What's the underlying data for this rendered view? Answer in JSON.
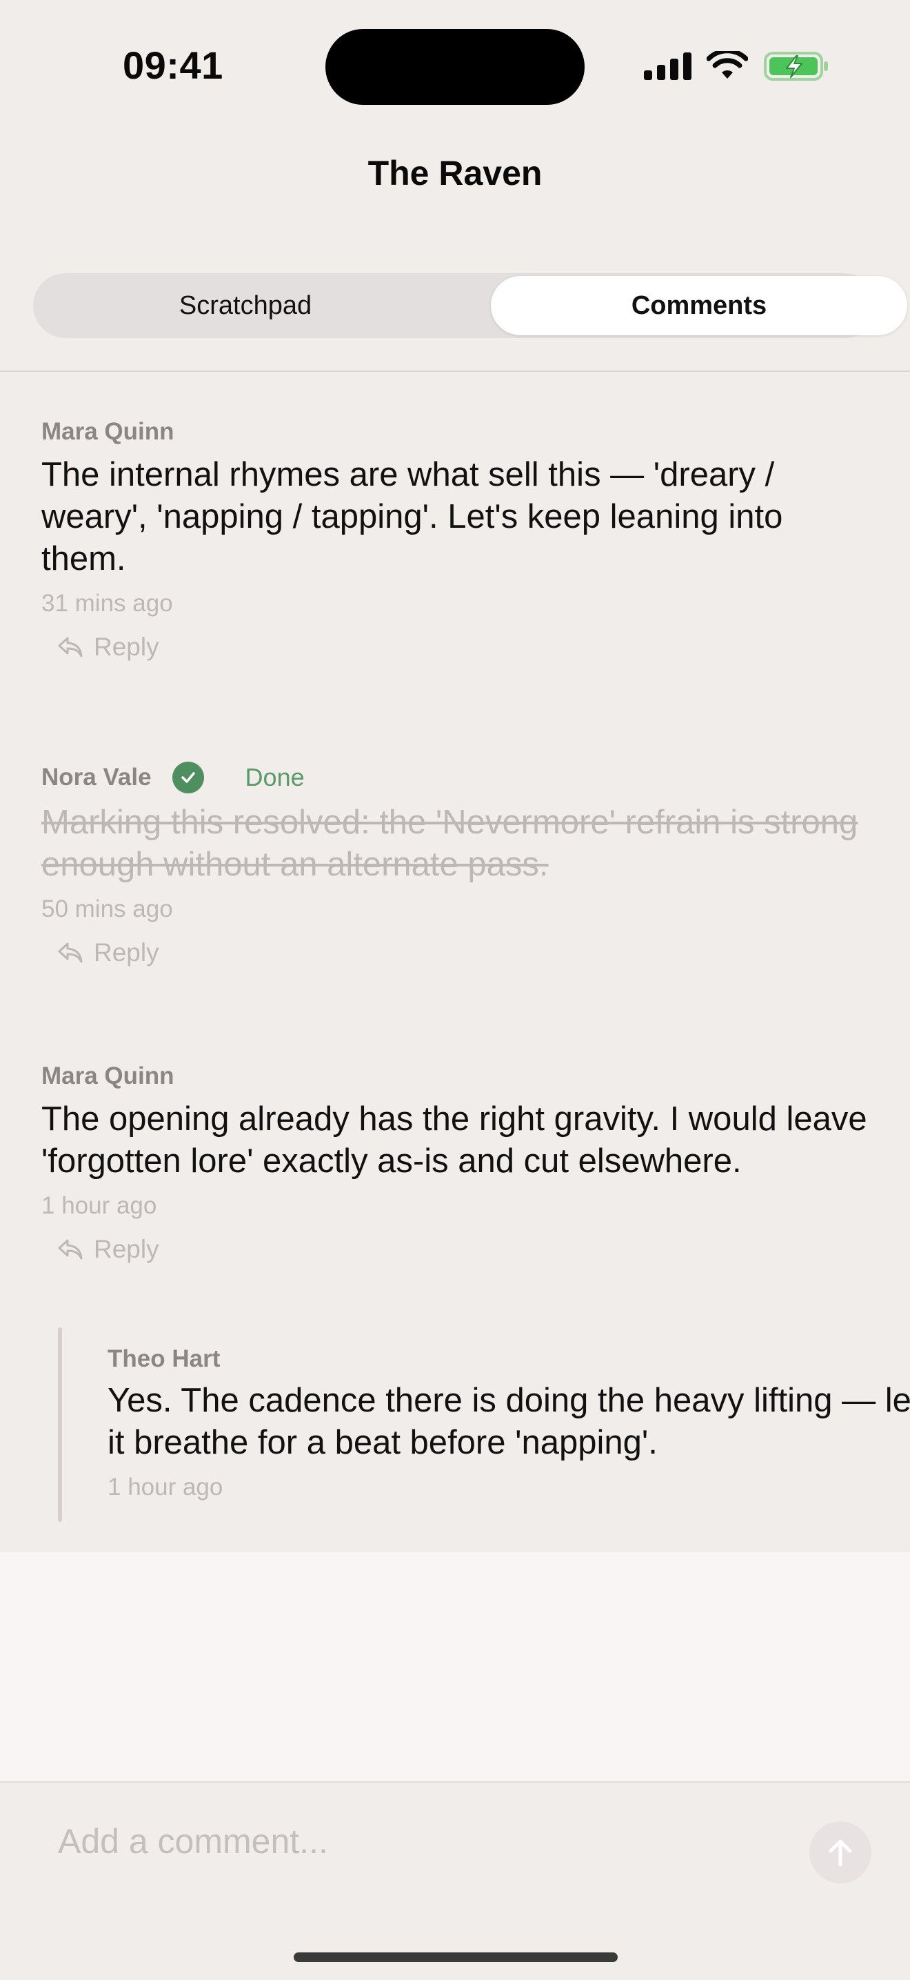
{
  "status_bar": {
    "time": "09:41"
  },
  "header": {
    "title": "The Raven"
  },
  "tabs": [
    {
      "label": "Scratchpad",
      "selected": false
    },
    {
      "label": "Comments",
      "selected": true
    }
  ],
  "comments": [
    {
      "author": "Mara Quinn",
      "text": "The internal rhymes are what sell this — 'dreary / weary', 'napping / tapping'. Let's keep leaning into them.",
      "time": "31 mins ago",
      "reply_label": "Reply"
    },
    {
      "author": "Nora Vale",
      "status": "Done",
      "text": "Marking this resolved: the 'Nevermore' refrain is strong enough without an alternate pass.",
      "time": "50 mins ago",
      "reply_label": "Reply"
    },
    {
      "author": "Mara Quinn",
      "text": "The opening already has the right gravity. I would leave 'forgotten lore' exactly as-is and cut elsewhere.",
      "time": "1 hour ago",
      "reply_label": "Reply",
      "replies": [
        {
          "author": "Theo Hart",
          "text": "Yes. The cadence there is doing the heavy lifting — let it breathe for a beat before 'napping'.",
          "time": "1 hour ago"
        }
      ]
    }
  ],
  "composer": {
    "placeholder": "Add a comment..."
  },
  "colors": {
    "resolved_green": "#4f8f5f",
    "background": "#f1edeb"
  },
  "icons": [
    "signal-icon",
    "wifi-icon",
    "battery-charging-icon",
    "reply-icon",
    "checkmark-icon",
    "send-arrow-icon"
  ]
}
